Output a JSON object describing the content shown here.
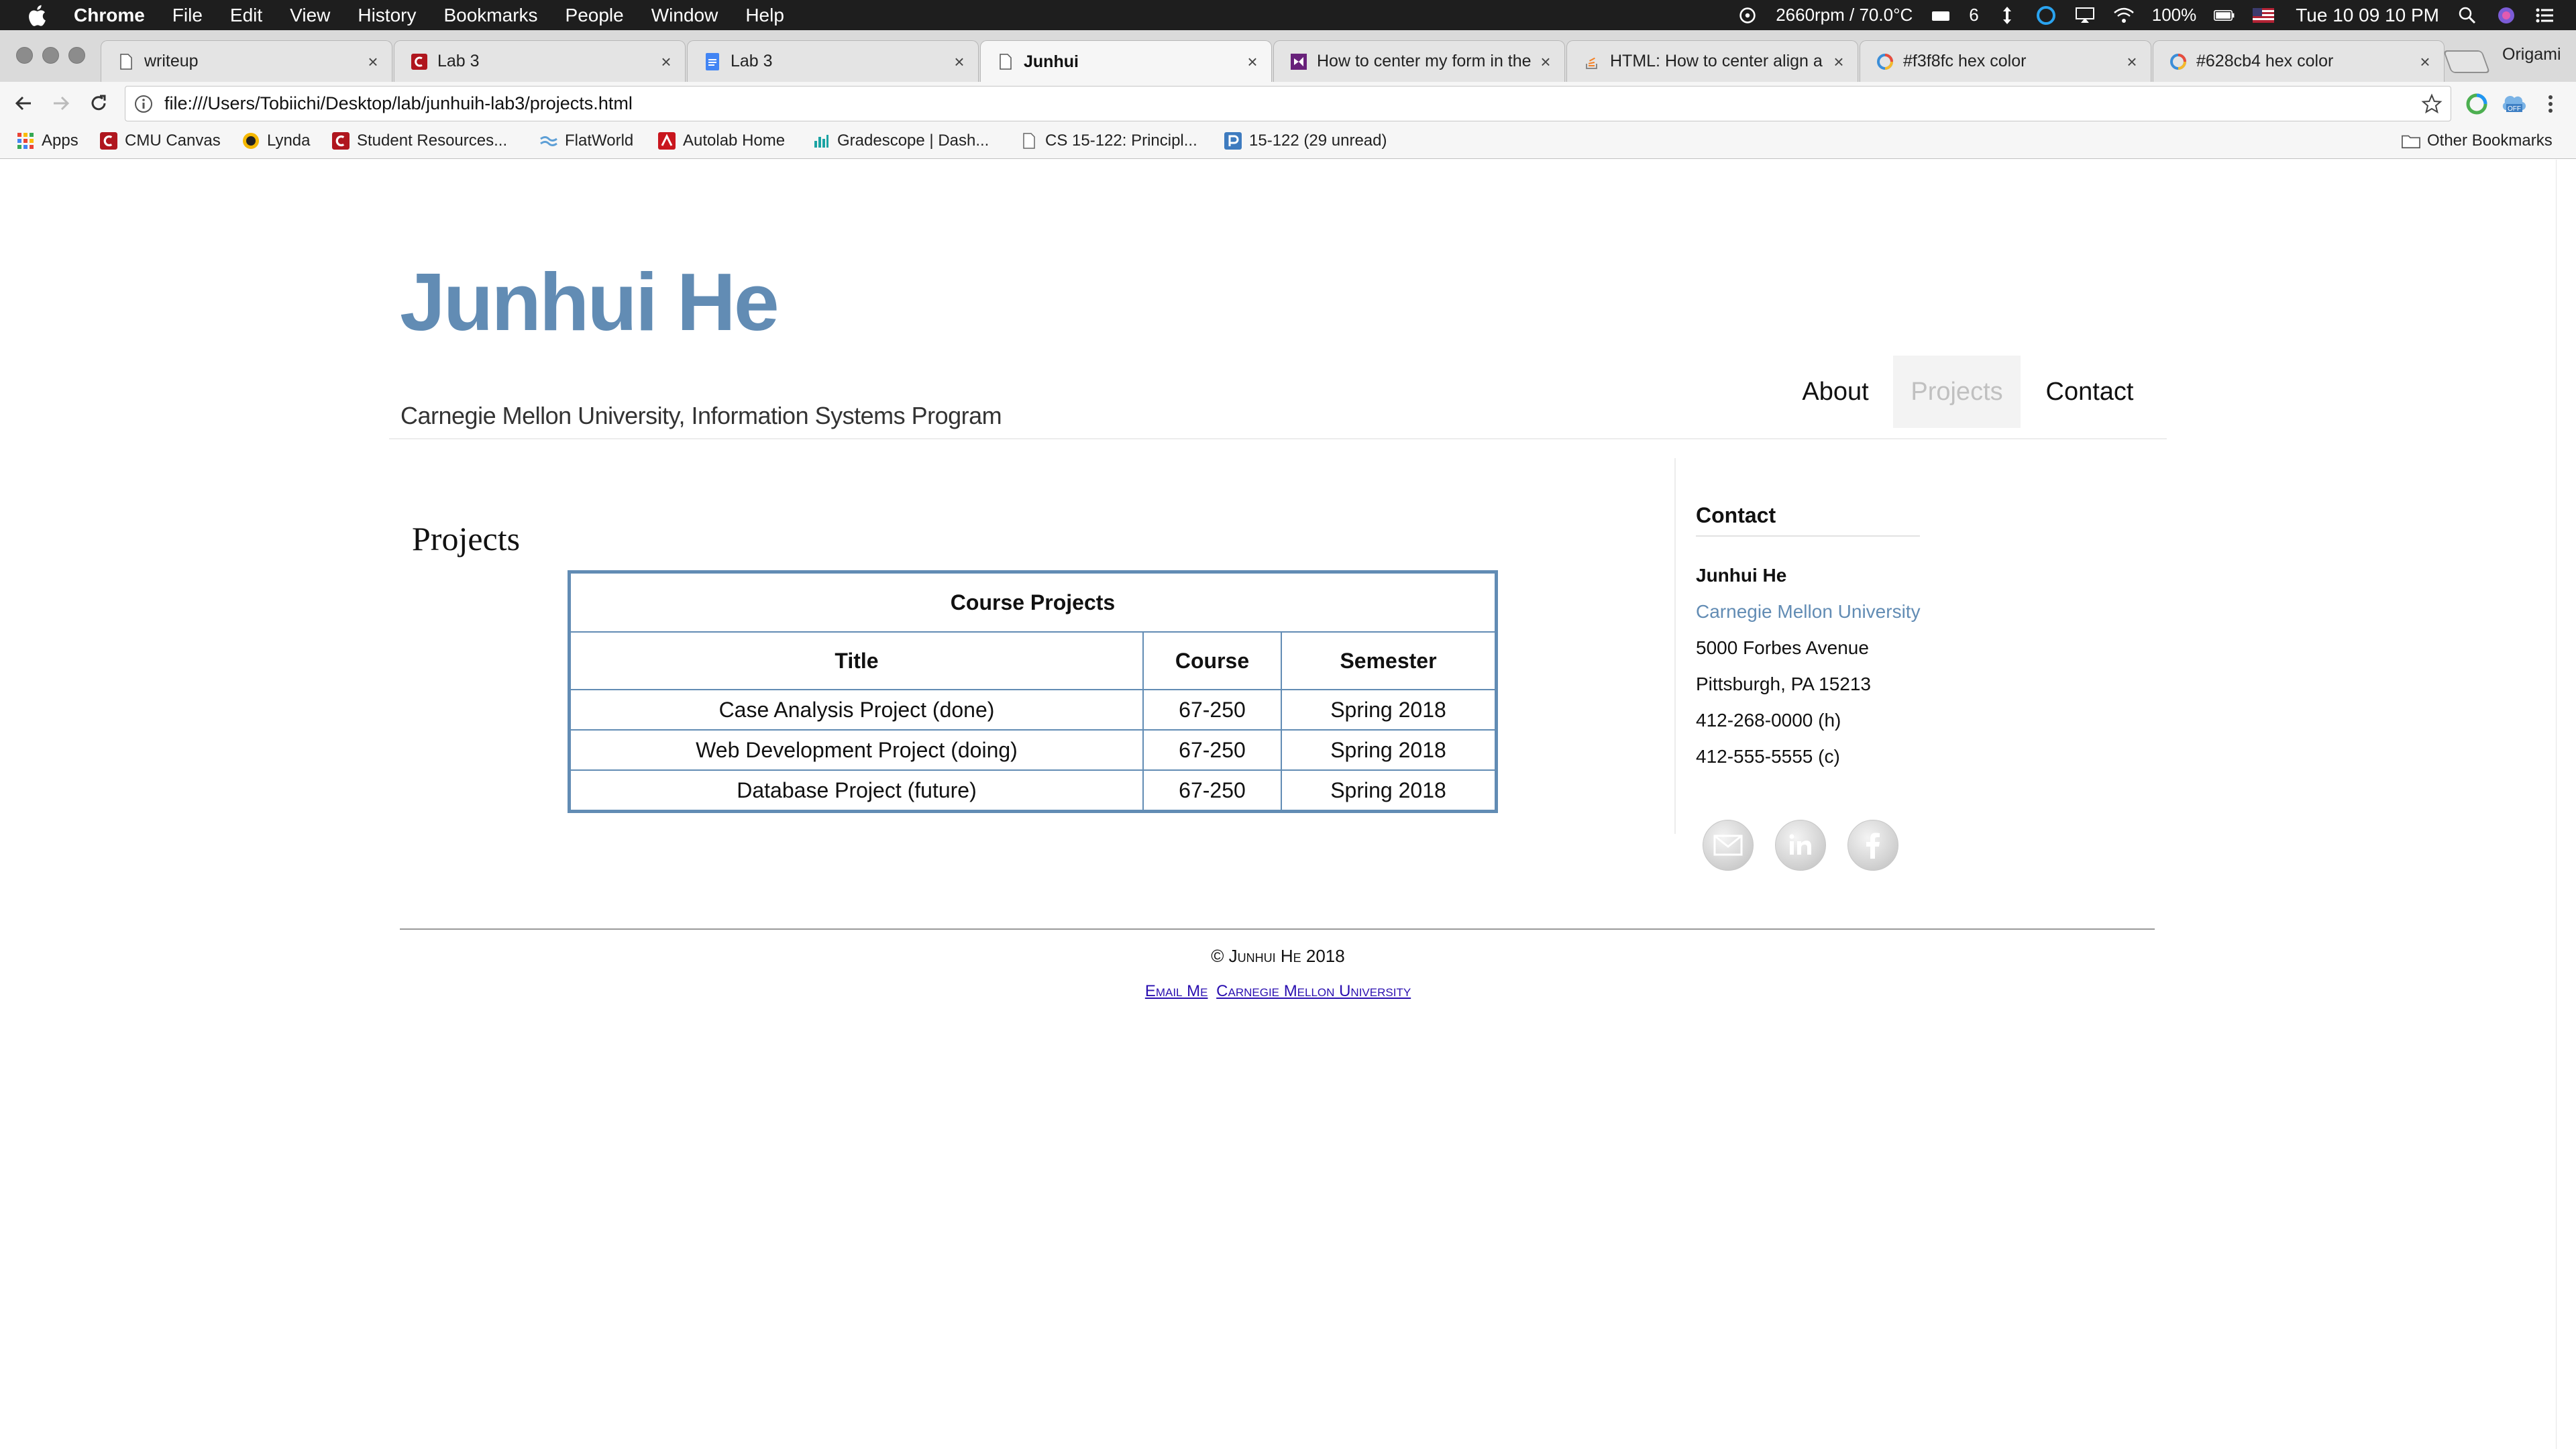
{
  "menubar": {
    "items": [
      "Chrome",
      "File",
      "Edit",
      "View",
      "History",
      "Bookmarks",
      "People",
      "Window",
      "Help"
    ],
    "fan": "2660rpm / 70.0°C",
    "badge": "6",
    "battery": "100%",
    "clock": "Tue 10 09 10 PM"
  },
  "tabs": [
    {
      "title": "writeup",
      "favicon": "doc-icon"
    },
    {
      "title": "Lab 3",
      "favicon": "canvas-icon"
    },
    {
      "title": "Lab 3",
      "favicon": "google-docs-icon"
    },
    {
      "title": "Junhui",
      "favicon": "doc-icon",
      "active": true
    },
    {
      "title": "How to center my form in the",
      "favicon": "visual-studio-icon"
    },
    {
      "title": "HTML: How to center align a",
      "favicon": "stackoverflow-icon"
    },
    {
      "title": "#f3f8fc hex color",
      "favicon": "colorhexa-icon"
    },
    {
      "title": "#628cb4 hex color",
      "favicon": "colorhexa-icon"
    }
  ],
  "profile_name": "Origami",
  "address": {
    "url": "file:///Users/Tobiichi/Desktop/lab/junhuih-lab3/projects.html"
  },
  "bookmarks": [
    {
      "label": "Apps",
      "icon": "apps-grid-icon"
    },
    {
      "label": "CMU Canvas",
      "icon": "canvas-icon"
    },
    {
      "label": "Lynda",
      "icon": "lynda-icon"
    },
    {
      "label": "Student Resources...",
      "icon": "canvas-icon"
    },
    {
      "label": "FlatWorld",
      "icon": "flatworld-icon"
    },
    {
      "label": "Autolab Home",
      "icon": "autolab-icon"
    },
    {
      "label": "Gradescope | Dash...",
      "icon": "gradescope-icon"
    },
    {
      "label": "CS 15-122: Principl...",
      "icon": "page-icon"
    },
    {
      "label": "15-122 (29 unread)",
      "icon": "piazza-icon"
    }
  ],
  "other_bookmarks": "Other Bookmarks",
  "site": {
    "title": "Junhui He",
    "subtitle": "Carnegie Mellon University, Information Systems Program",
    "nav": [
      "About",
      "Projects",
      "Contact"
    ],
    "active_nav": "Projects",
    "accent_color": "#628cb4"
  },
  "main": {
    "heading": "Projects",
    "table": {
      "caption": "Course Projects",
      "headers": [
        "Title",
        "Course",
        "Semester"
      ],
      "rows": [
        [
          "Case Analysis Project (done)",
          "67-250",
          "Spring 2018"
        ],
        [
          "Web Development Project (doing)",
          "67-250",
          "Spring 2018"
        ],
        [
          "Database Project (future)",
          "67-250",
          "Spring 2018"
        ]
      ]
    }
  },
  "sidebar": {
    "heading": "Contact",
    "name": "Junhui He",
    "university": "Carnegie Mellon University",
    "address1": "5000 Forbes Avenue",
    "address2": "Pittsburgh, PA 15213",
    "phone_h": "412-268-0000 (h)",
    "phone_c": "412-555-5555 (c)",
    "social": [
      "email-icon",
      "linkedin-icon",
      "facebook-icon"
    ]
  },
  "footer": {
    "copyright": "© Junhui He 2018",
    "links": [
      "Email Me",
      "Carnegie Mellon University"
    ]
  }
}
